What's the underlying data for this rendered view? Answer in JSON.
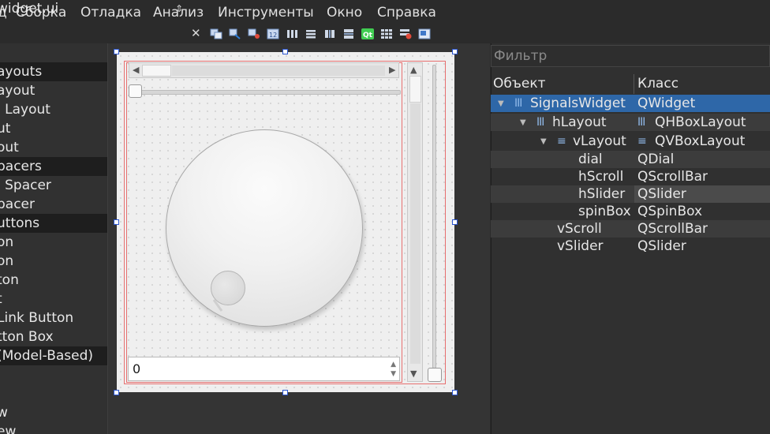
{
  "menu": [
    "д",
    "Сборка",
    "Отладка",
    "Анализ",
    "Инструменты",
    "Окно",
    "Справка"
  ],
  "file_combo": {
    "value": "widget.ui",
    "arrows": "⇕"
  },
  "close_symbol": "✕",
  "widget_box": {
    "rows": [
      {
        "label": "ayouts",
        "category": true
      },
      {
        "label": "ayout",
        "category": false
      },
      {
        "label": "l Layout",
        "category": false
      },
      {
        "label": "ut",
        "category": false
      },
      {
        "label": "out",
        "category": false
      },
      {
        "label": "pacers",
        "category": true
      },
      {
        "label": "l Spacer",
        "category": false
      },
      {
        "label": "pacer",
        "category": false
      },
      {
        "label": "uttons",
        "category": true
      },
      {
        "label": "on",
        "category": false
      },
      {
        "label": "on",
        "category": false
      },
      {
        "label": "ton",
        "category": false
      },
      {
        "label": "t",
        "category": false
      },
      {
        "label": " Link Button",
        "category": false
      },
      {
        "label": "tton Box",
        "category": false
      },
      {
        "label": " (Model-Based)",
        "category": true
      },
      {
        "label": "",
        "category": false
      },
      {
        "label": "",
        "category": false
      },
      {
        "label": "w",
        "category": false
      },
      {
        "label": "ew",
        "category": false
      }
    ]
  },
  "form": {
    "spinbox_value": "0",
    "dial_value": 0
  },
  "inspector": {
    "filter_placeholder": "Фильтр",
    "col_object": "Объект",
    "col_class": "Класс",
    "rows": [
      {
        "object": "SignalsWidget",
        "class": "QWidget",
        "layout_icon": "III",
        "class_icon": "",
        "selected": true
      },
      {
        "object": "hLayout",
        "class": "QHBoxLayout",
        "layout_icon": "III",
        "class_icon": "III"
      },
      {
        "object": "vLayout",
        "class": "QVBoxLayout",
        "layout_icon": "≡",
        "class_icon": "≡"
      },
      {
        "object": "dial",
        "class": "QDial"
      },
      {
        "object": "hScroll",
        "class": "QScrollBar"
      },
      {
        "object": "hSlider",
        "class": "QSlider"
      },
      {
        "object": "spinBox",
        "class": "QSpinBox"
      },
      {
        "object": "vScroll",
        "class": "QScrollBar"
      },
      {
        "object": "vSlider",
        "class": "QSlider"
      }
    ]
  },
  "colors": {
    "selection": "#2e67a8",
    "form_outline": "#e76f6f",
    "handle_border": "#2a55d0"
  }
}
